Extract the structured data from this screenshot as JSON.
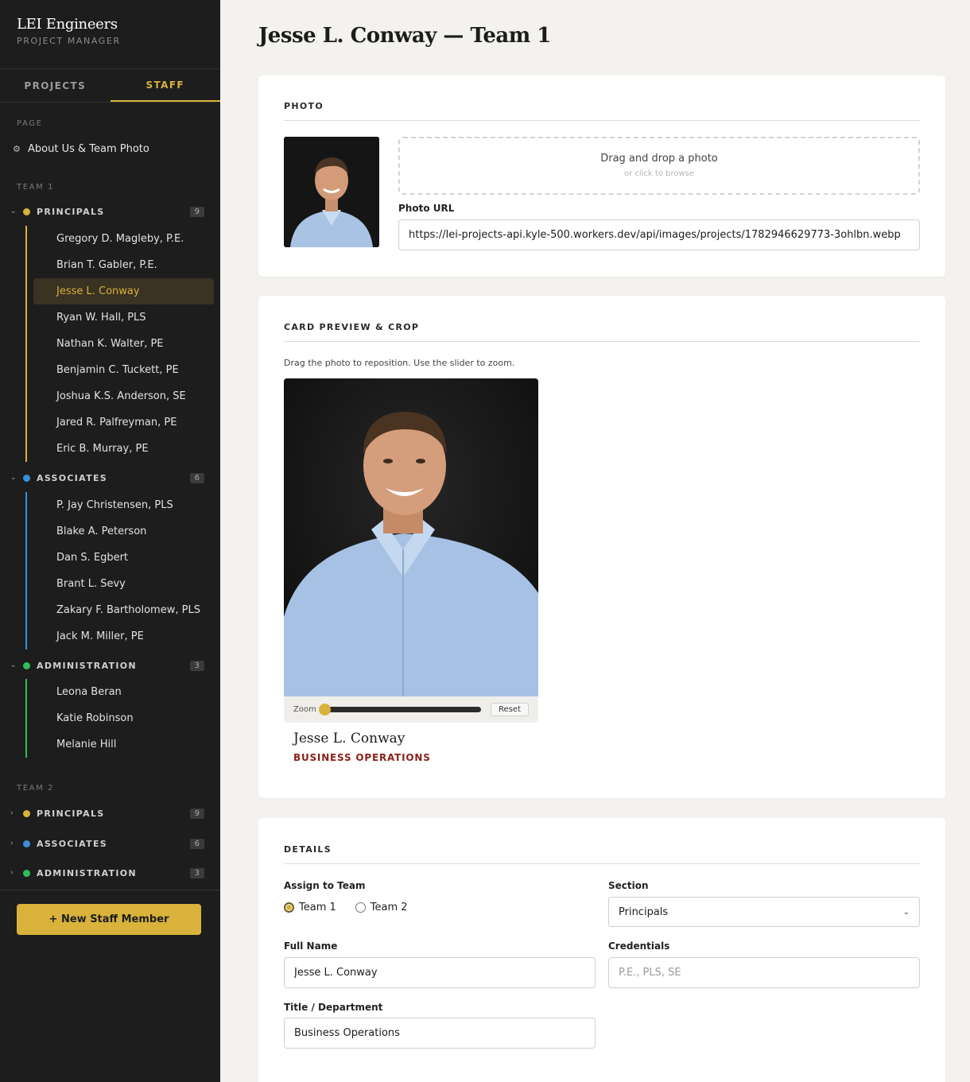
{
  "brand": {
    "name": "LEI Engineers",
    "subtitle": "PROJECT MANAGER"
  },
  "tabs": [
    {
      "label": "PROJECTS",
      "active": false
    },
    {
      "label": "STAFF",
      "active": true
    }
  ],
  "sidebar": {
    "page_label": "PAGE",
    "page_item": "About Us & Team Photo",
    "team1_label": "TEAM 1",
    "team2_label": "TEAM 2",
    "team1": {
      "principals": {
        "title": "PRINCIPALS",
        "count": "9",
        "color": "#d8b23a",
        "members": [
          "Gregory D. Magleby, P.E.",
          "Brian T. Gabler, P.E.",
          "Jesse L. Conway",
          "Ryan W. Hall, PLS",
          "Nathan K. Walter, PE",
          "Benjamin C. Tuckett, PE",
          "Joshua K.S. Anderson, SE",
          "Jared R. Palfreyman, PE",
          "Eric B. Murray, PE"
        ]
      },
      "associates": {
        "title": "ASSOCIATES",
        "count": "6",
        "color": "#3a8fd8",
        "members": [
          "P. Jay Christensen, PLS",
          "Blake A. Peterson",
          "Dan S. Egbert",
          "Brant L. Sevy",
          "Zakary F. Bartholomew, PLS",
          "Jack M. Miller, PE"
        ]
      },
      "administration": {
        "title": "ADMINISTRATION",
        "count": "3",
        "color": "#2fbf5a",
        "members": [
          "Leona Beran",
          "Katie Robinson",
          "Melanie Hill"
        ]
      }
    },
    "team2": {
      "principals": {
        "title": "PRINCIPALS",
        "count": "9"
      },
      "associates": {
        "title": "ASSOCIATES",
        "count": "6"
      },
      "administration": {
        "title": "ADMINISTRATION",
        "count": "3"
      }
    },
    "new_button": "+ New Staff Member"
  },
  "main": {
    "title": "Jesse L. Conway — Team 1",
    "photo": {
      "heading": "PHOTO",
      "drop_main": "Drag and drop a photo",
      "drop_sub": "or click to browse",
      "url_label": "Photo URL",
      "url_value": "https://lei-projects-api.kyle-500.workers.dev/api/images/projects/1782946629773-3ohlbn.webp"
    },
    "preview": {
      "heading": "CARD PREVIEW & CROP",
      "hint": "Drag the photo to reposition. Use the slider to zoom.",
      "zoom_label": "Zoom",
      "zoom_level": 0,
      "reset_label": "Reset",
      "name": "Jesse L. Conway",
      "title": "BUSINESS OPERATIONS"
    },
    "details": {
      "heading": "DETAILS",
      "assign_label": "Assign to Team",
      "team_options": [
        "Team 1",
        "Team 2"
      ],
      "selected_team": "Team 1",
      "section_label": "Section",
      "section_value": "Principals",
      "fullname_label": "Full Name",
      "fullname_value": "Jesse L. Conway",
      "credentials_label": "Credentials",
      "credentials_placeholder": "P.E., PLS, SE",
      "dept_label": "Title / Department",
      "dept_value": "Business Operations"
    }
  },
  "colors": {
    "accent": "#d8b23a",
    "sidebar_bg": "#1d1d1d",
    "title_red": "#8a1f1a"
  }
}
